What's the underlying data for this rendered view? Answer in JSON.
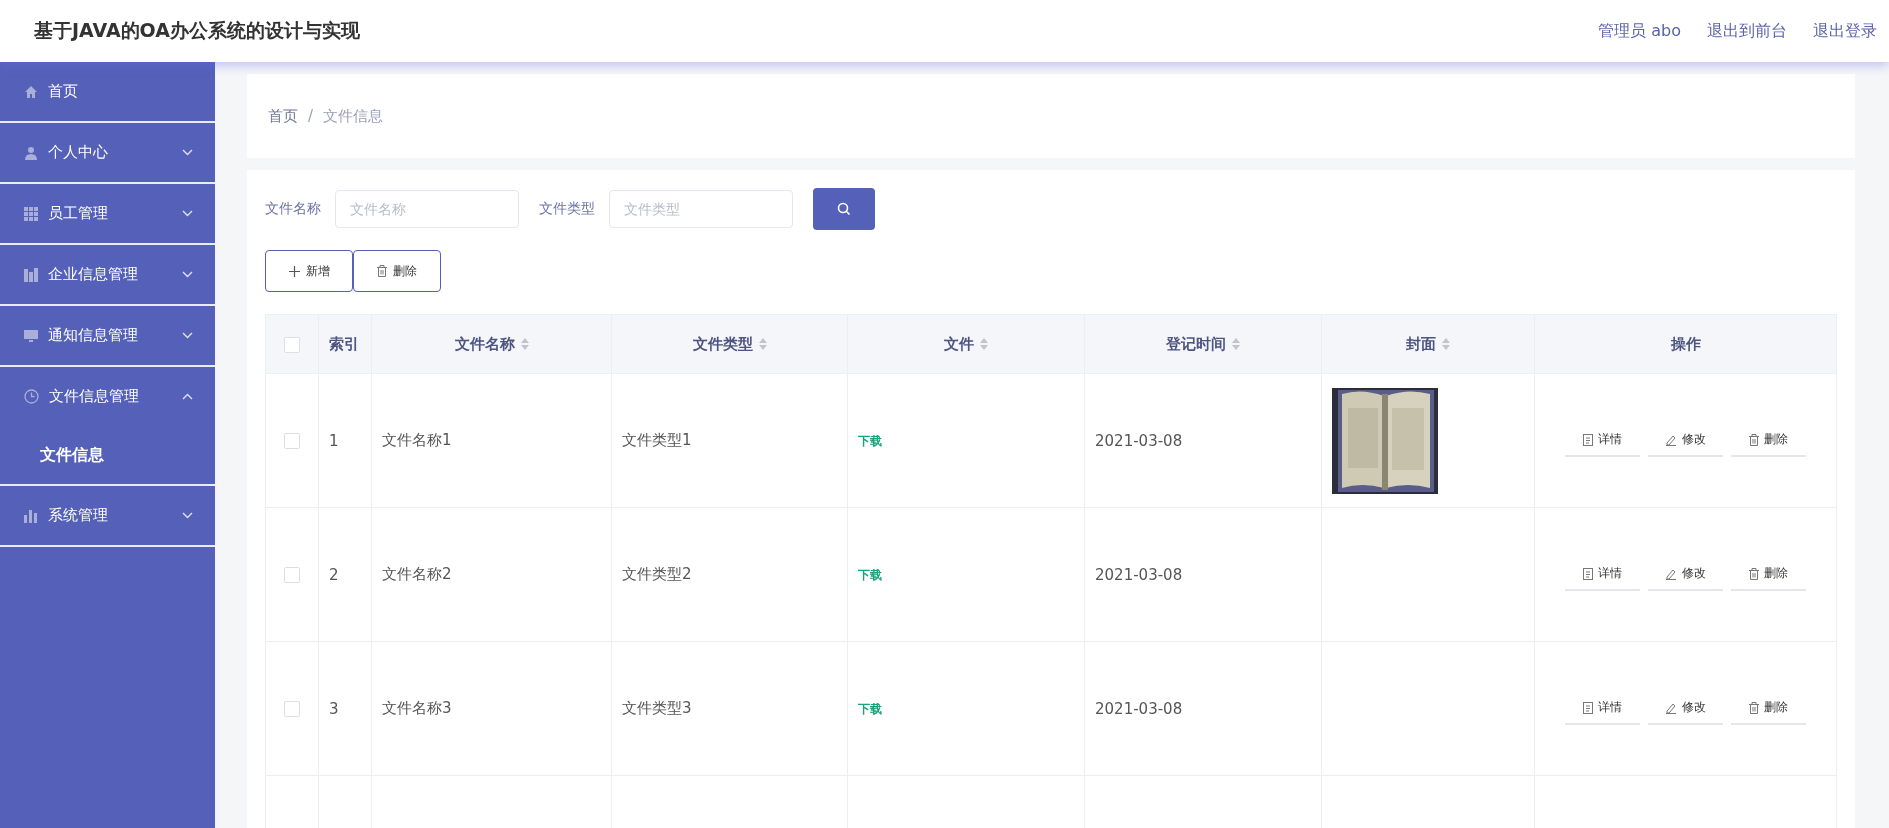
{
  "header": {
    "title": "基于JAVA的OA办公系统的设计与实现",
    "links": [
      "管理员 abo",
      "退出到前台",
      "退出登录"
    ]
  },
  "sidebar": {
    "items": [
      {
        "label": "首页"
      },
      {
        "label": "个人中心",
        "expanded": false
      },
      {
        "label": "员工管理",
        "expanded": false
      },
      {
        "label": "企业信息管理",
        "expanded": false
      },
      {
        "label": "通知信息管理",
        "expanded": false
      },
      {
        "label": "文件信息管理",
        "expanded": true,
        "children": [
          {
            "label": "文件信息",
            "selected": true
          }
        ]
      },
      {
        "label": "系统管理",
        "expanded": false
      }
    ]
  },
  "breadcrumb": [
    {
      "label": "首页",
      "kind": "link"
    },
    {
      "label": "/",
      "kind": "separator"
    },
    {
      "label": "文件信息",
      "kind": "current"
    }
  ],
  "search": {
    "fields": [
      {
        "label": "文件名称",
        "placeholder": "文件名称"
      },
      {
        "label": "文件类型",
        "placeholder": "文件类型"
      }
    ]
  },
  "toolbar": [
    {
      "label": "新增",
      "kind": "add"
    },
    {
      "label": "删除",
      "kind": "delete"
    }
  ],
  "table": {
    "columns": [
      {
        "kind": "checkbox",
        "checked": false
      },
      {
        "label": "索引",
        "sortable": false
      },
      {
        "label": "文件名称",
        "sortable": true
      },
      {
        "label": "文件类型",
        "sortable": true
      },
      {
        "label": "文件",
        "sortable": true
      },
      {
        "label": "登记时间",
        "sortable": true
      },
      {
        "label": "封面",
        "sortable": true
      },
      {
        "label": "操作",
        "sortable": false
      }
    ],
    "rows": [
      {
        "checked": false,
        "index": "1",
        "name": "文件名称1",
        "type": "文件类型1",
        "file": "下载",
        "date": "2021-03-08",
        "actions": [
          {
            "label": "详情",
            "kind": "detail"
          },
          {
            "label": "修改",
            "kind": "edit"
          },
          {
            "label": "删除",
            "kind": "delete"
          }
        ]
      },
      {
        "checked": false,
        "index": "2",
        "name": "文件名称2",
        "type": "文件类型2",
        "file": "下载",
        "date": "2021-03-08",
        "actions": [
          {
            "label": "详情",
            "kind": "detail"
          },
          {
            "label": "修改",
            "kind": "edit"
          },
          {
            "label": "删除",
            "kind": "delete"
          }
        ]
      },
      {
        "checked": false,
        "index": "3",
        "name": "文件名称3",
        "type": "文件类型3",
        "file": "下载",
        "date": "2021-03-08",
        "actions": [
          {
            "label": "详情",
            "kind": "detail"
          },
          {
            "label": "修改",
            "kind": "edit"
          },
          {
            "label": "删除",
            "kind": "delete"
          }
        ]
      }
    ]
  }
}
